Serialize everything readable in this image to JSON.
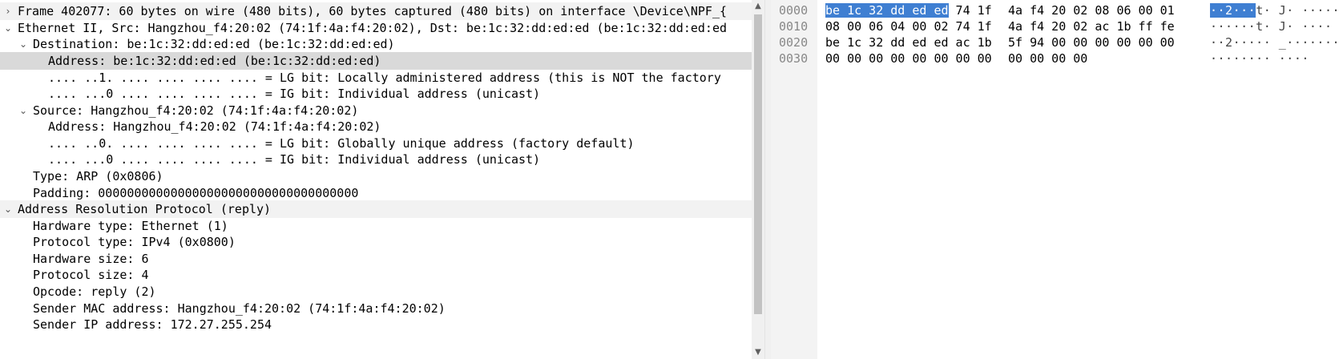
{
  "details": {
    "rows": [
      {
        "text": "Frame 402077: 60 bytes on wire (480 bits), 60 bytes captured (480 bits) on interface \\Device\\NPF_{",
        "twisty": "›"
      },
      {
        "text": "Ethernet II, Src: Hangzhou_f4:20:02 (74:1f:4a:f4:20:02), Dst: be:1c:32:dd:ed:ed (be:1c:32:dd:ed:ed",
        "twisty": "⌄"
      },
      {
        "text": "Destination: be:1c:32:dd:ed:ed (be:1c:32:dd:ed:ed)",
        "twisty": "⌄"
      },
      {
        "text": "Address: be:1c:32:dd:ed:ed (be:1c:32:dd:ed:ed)",
        "twisty": ""
      },
      {
        "text": ".... ..1. .... .... .... .... = LG bit: Locally administered address (this is NOT the factory",
        "twisty": ""
      },
      {
        "text": ".... ...0 .... .... .... .... = IG bit: Individual address (unicast)",
        "twisty": ""
      },
      {
        "text": "Source: Hangzhou_f4:20:02 (74:1f:4a:f4:20:02)",
        "twisty": "⌄"
      },
      {
        "text": "Address: Hangzhou_f4:20:02 (74:1f:4a:f4:20:02)",
        "twisty": ""
      },
      {
        "text": ".... ..0. .... .... .... .... = LG bit: Globally unique address (factory default)",
        "twisty": ""
      },
      {
        "text": ".... ...0 .... .... .... .... = IG bit: Individual address (unicast)",
        "twisty": ""
      },
      {
        "text": "Type: ARP (0x0806)",
        "twisty": ""
      },
      {
        "text": "Padding: 000000000000000000000000000000000000",
        "twisty": ""
      },
      {
        "text": "Address Resolution Protocol (reply)",
        "twisty": "⌄"
      },
      {
        "text": "Hardware type: Ethernet (1)",
        "twisty": ""
      },
      {
        "text": "Protocol type: IPv4 (0x0800)",
        "twisty": ""
      },
      {
        "text": "Hardware size: 6",
        "twisty": ""
      },
      {
        "text": "Protocol size: 4",
        "twisty": ""
      },
      {
        "text": "Opcode: reply (2)",
        "twisty": ""
      },
      {
        "text": "Sender MAC address: Hangzhou_f4:20:02 (74:1f:4a:f4:20:02)",
        "twisty": ""
      },
      {
        "text": "Sender IP address: 172.27.255.254",
        "twisty": ""
      }
    ]
  },
  "bytes": {
    "rows": [
      {
        "offset": "0000",
        "hex1_hl": "be 1c 32 dd ed ed",
        "hex1_rest": " 74 1f",
        "hex2": "4a f4 20 02 08 06 00 01",
        "ascii_hl": "··2···",
        "ascii_rest": "t· J· ·····"
      },
      {
        "offset": "0010",
        "hex1_hl": "",
        "hex1_rest": "08 00 06 04 00 02 74 1f",
        "hex2": "4a f4 20 02 ac 1b ff fe",
        "ascii_hl": "",
        "ascii_rest": "······t· J· ····"
      },
      {
        "offset": "0020",
        "hex1_hl": "",
        "hex1_rest": "be 1c 32 dd ed ed ac 1b",
        "hex2": "5f 94 00 00 00 00 00 00",
        "ascii_hl": "",
        "ascii_rest": "··2····· _·······"
      },
      {
        "offset": "0030",
        "hex1_hl": "",
        "hex1_rest": "00 00 00 00 00 00 00 00",
        "hex2": "00 00 00 00",
        "ascii_hl": "",
        "ascii_rest": "········ ····"
      }
    ]
  },
  "colors": {
    "selection": "#3f7fd2",
    "selected_row": "#d9d9d9"
  }
}
